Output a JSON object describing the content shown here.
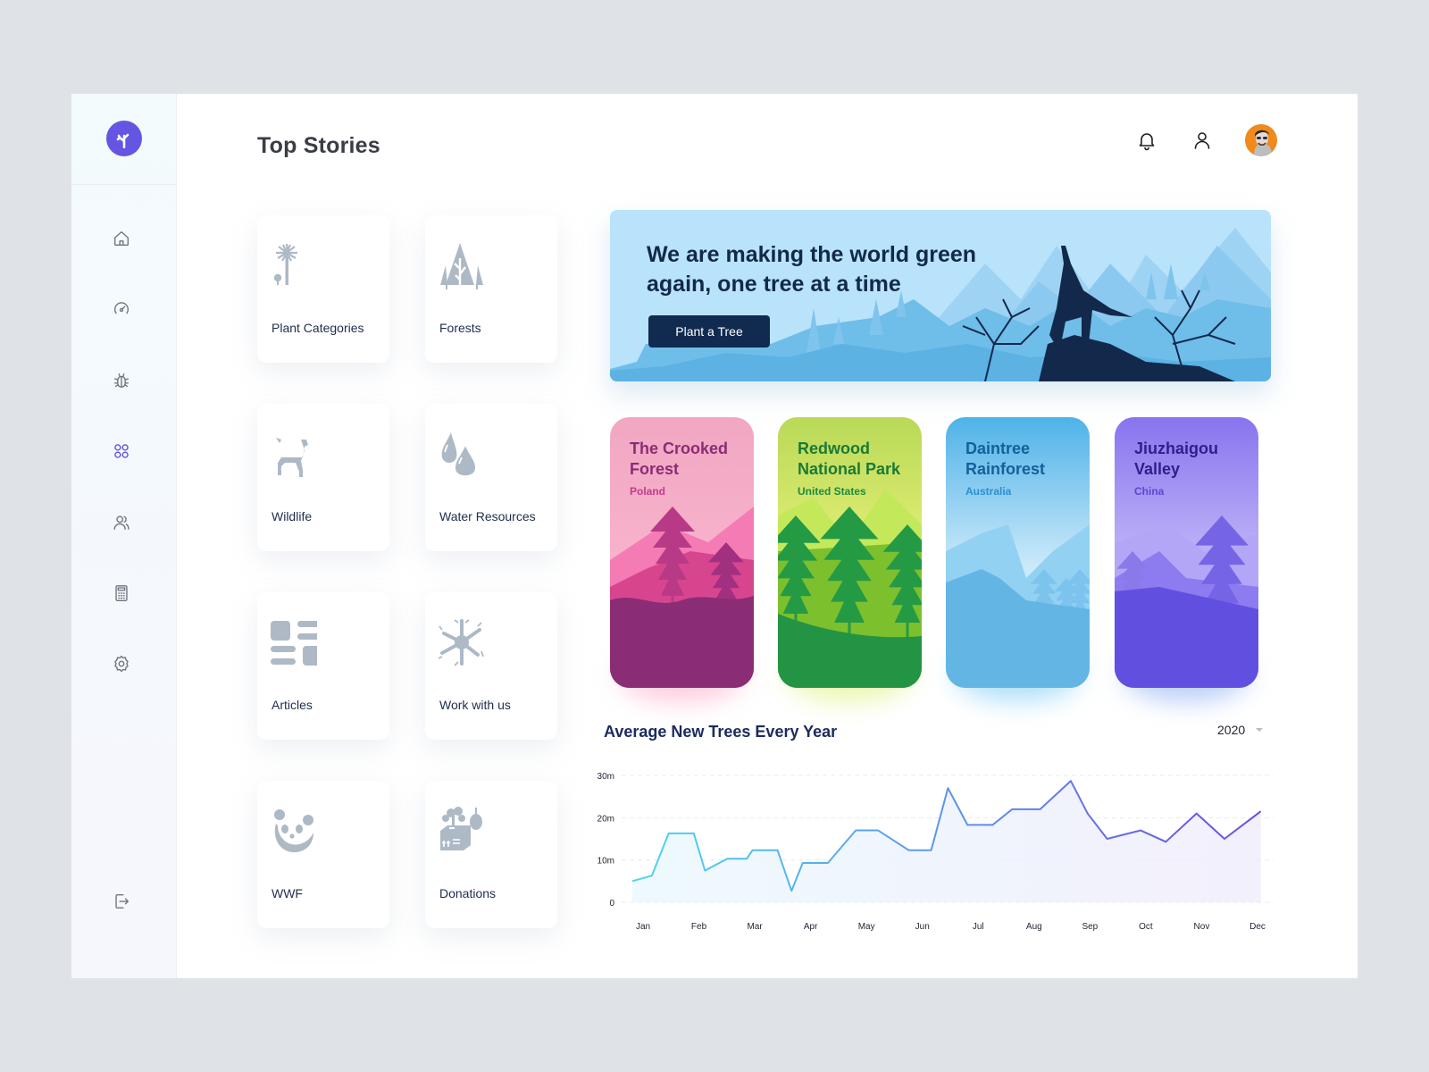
{
  "brand": {
    "logo_icon": "tree-icon",
    "accent": "#6455e3"
  },
  "sidebar": {
    "items": [
      {
        "name": "home",
        "icon": "home-icon",
        "active": false
      },
      {
        "name": "dashboard",
        "icon": "speedometer-icon",
        "active": false
      },
      {
        "name": "bugs",
        "icon": "bug-icon",
        "active": false
      },
      {
        "name": "apps",
        "icon": "grid-icon",
        "active": true
      },
      {
        "name": "users",
        "icon": "users-icon",
        "active": false
      },
      {
        "name": "calculator",
        "icon": "calculator-icon",
        "active": false
      },
      {
        "name": "settings",
        "icon": "gear-icon",
        "active": false
      }
    ],
    "logout_icon": "logout-icon"
  },
  "header": {
    "title": "Top Stories",
    "icons": [
      "bell-icon",
      "user-icon",
      "avatar"
    ]
  },
  "tiles": [
    {
      "label": "Plant Categories",
      "icon": "palm-tree-icon"
    },
    {
      "label": "Forests",
      "icon": "forest-icon"
    },
    {
      "label": "Wildlife",
      "icon": "deer-icon"
    },
    {
      "label": "Water Resources",
      "icon": "water-drops-icon"
    },
    {
      "label": "Articles",
      "icon": "articles-icon"
    },
    {
      "label": "Work with us",
      "icon": "hands-icon"
    },
    {
      "label": "WWF",
      "icon": "panda-icon"
    },
    {
      "label": "Donations",
      "icon": "donation-box-icon"
    }
  ],
  "hero": {
    "title": "We are making the world green again, one tree at a time",
    "button_label": "Plant a Tree"
  },
  "destinations": [
    {
      "name": "The Crooked Forest",
      "country": "Poland",
      "colors": {
        "top": "#f1a7c2",
        "mid": "#f47bb4",
        "dark": "#8b2c76",
        "title": "#8b2c76",
        "country": "#c23a8d",
        "glow": "#ff9fbf"
      }
    },
    {
      "name": "Redwood National Park",
      "country": "United States",
      "colors": {
        "top": "#b9d957",
        "mid": "#7cc02e",
        "dark": "#239444",
        "title": "#1b7a37",
        "country": "#1f8a3e",
        "glow": "#d8f06a"
      }
    },
    {
      "name": "Daintree Rainforest",
      "country": "Australia",
      "colors": {
        "top": "#4fb2e8",
        "mid": "#93d1f3",
        "dark": "#63b6e4",
        "title": "#14609a",
        "country": "#2a8ed0",
        "glow": "#6cc6f5"
      }
    },
    {
      "name": "Jiuzhaigou Valley",
      "country": "China",
      "colors": {
        "top": "#8874ee",
        "mid": "#a99af3",
        "dark": "#6150e0",
        "title": "#2e1f8c",
        "country": "#5b47d6",
        "glow": "#7ea6f3"
      }
    }
  ],
  "chart": {
    "title": "Average New Trees Every Year",
    "year_selected": "2020"
  },
  "chart_data": {
    "type": "area",
    "title": "Average New Trees Every Year",
    "xlabel": "",
    "ylabel": "",
    "categories": [
      "Jan",
      "Feb",
      "Mar",
      "Apr",
      "May",
      "Jun",
      "Jul",
      "Aug",
      "Sep",
      "Oct",
      "Nov",
      "Dec"
    ],
    "yticks": [
      "0",
      "10m",
      "20m",
      "30m"
    ],
    "ylim": [
      0,
      30
    ],
    "grid": true,
    "unit": "millions",
    "x": [
      0.0,
      0.35,
      0.65,
      1.1,
      1.3,
      1.7,
      2.05,
      2.15,
      2.6,
      2.85,
      3.05,
      3.5,
      4.0,
      4.4,
      4.95,
      5.35,
      5.65,
      6.0,
      6.45,
      6.8,
      7.3,
      7.85,
      8.15,
      8.5,
      9.1,
      9.55,
      10.1,
      10.6,
      11.25
    ],
    "values": [
      5,
      6.3,
      16.3,
      16.3,
      7.5,
      10.3,
      10.3,
      12.3,
      12.3,
      2.7,
      9.3,
      9.3,
      17,
      17,
      12.3,
      12.3,
      27,
      18.3,
      18.3,
      22,
      22,
      28.7,
      21,
      15,
      17,
      14.3,
      21,
      15,
      21.5
    ],
    "line_gradient": [
      "#4fd5ef",
      "#5f94e8",
      "#6a4de4"
    ]
  }
}
